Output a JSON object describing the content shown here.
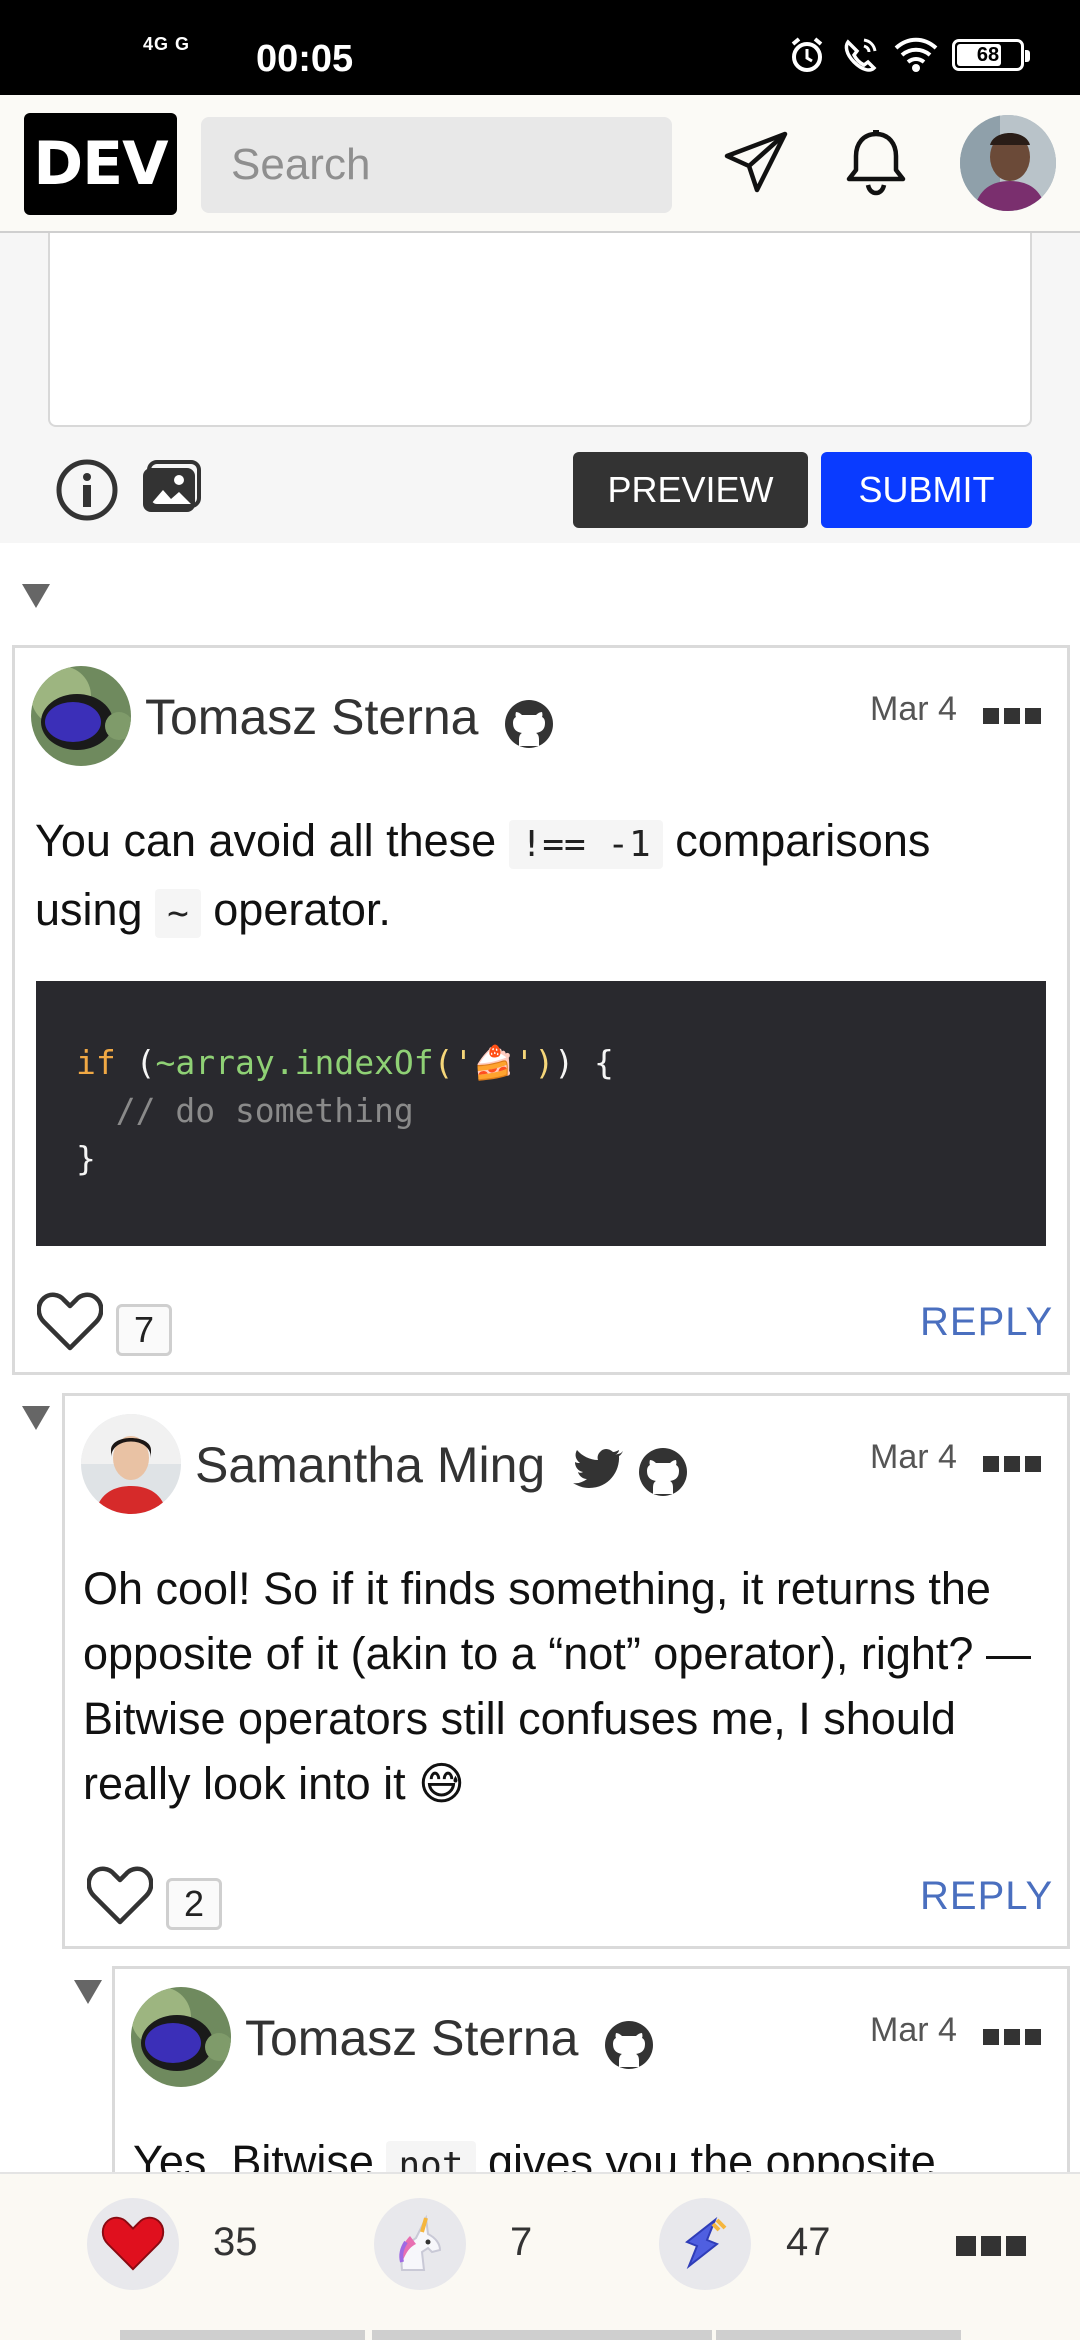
{
  "status_bar": {
    "network": "4G G",
    "time": "00:05",
    "battery": "68"
  },
  "header": {
    "logo": "DEV",
    "search_placeholder": "Search"
  },
  "comment_form": {
    "preview_label": "PREVIEW",
    "submit_label": "SUBMIT"
  },
  "comments": [
    {
      "author": "Tomasz Sterna",
      "date": "Mar 4",
      "text_before": "You can avoid all these ",
      "code1": "!== -1",
      "text_middle": " comparisons using ",
      "code2": "~",
      "text_after": " operator.",
      "code_line1_kw": "if",
      "code_line1_rest": " (",
      "code_line1_tilde": "~array",
      "code_line1_method": ".indexOf",
      "code_line1_str": "('🍰')",
      "code_line1_end": ") {",
      "code_line2": "  // do something",
      "code_line3": "}",
      "likes": "7",
      "reply": "REPLY"
    },
    {
      "author": "Samantha Ming",
      "date": "Mar 4",
      "text": "Oh cool! So if it finds something, it returns the opposite of it (akin to a “not” operator), right? — Bitwise operators still confuses me, I should really look into it 😅",
      "likes": "2",
      "reply": "REPLY"
    },
    {
      "author": "Tomasz Sterna",
      "date": "Mar 4",
      "text_before": "Yes. Bitwise ",
      "code": "not",
      "text_after": " gives you the opposite"
    }
  ],
  "bottom_bar": {
    "hearts": "35",
    "unicorns": "7",
    "bookmarks": "47"
  }
}
